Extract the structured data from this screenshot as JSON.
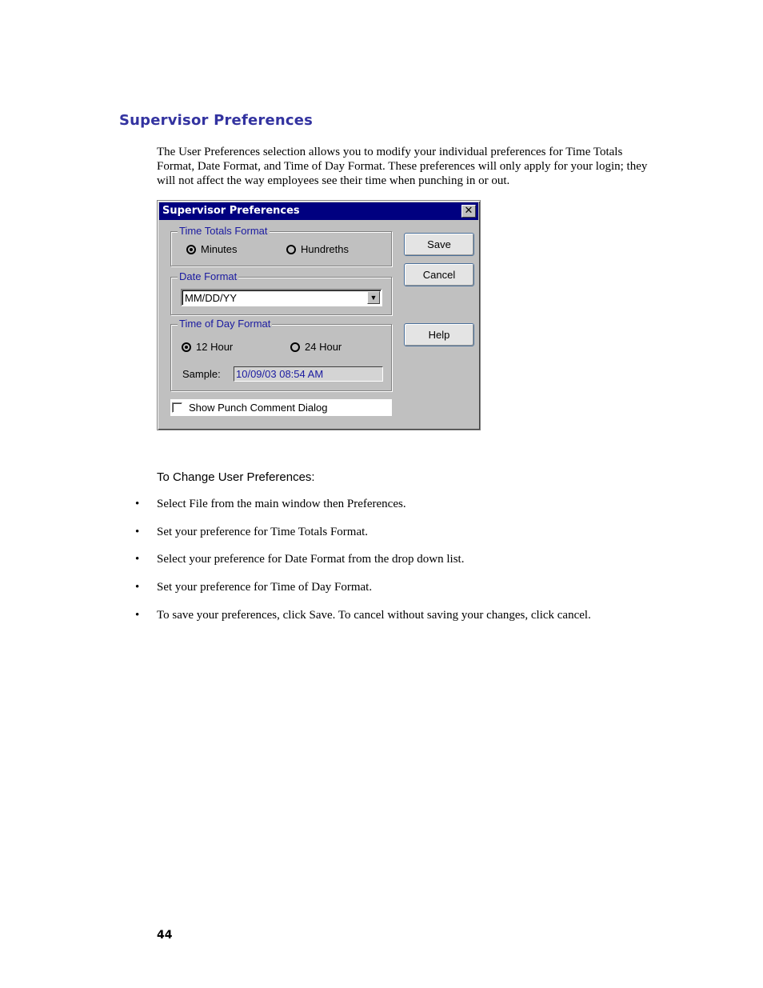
{
  "section_heading": "Supervisor Preferences",
  "intro_text": "The User Preferences selection allows you to modify your individual preferences for Time Totals Format, Date Format, and Time of Day Format. These preferences will only apply for your login; they will not affect the way employees see their time when punching in or out.",
  "dialog": {
    "title": "Supervisor Preferences",
    "close_icon": "close-icon",
    "time_totals": {
      "label": "Time Totals Format",
      "options": [
        {
          "label": "Minutes",
          "checked": true
        },
        {
          "label": "Hundreths",
          "checked": false
        }
      ]
    },
    "date_format": {
      "label": "Date Format",
      "value": "MM/DD/YY",
      "arrow_icon": "dropdown-arrow-icon"
    },
    "time_of_day": {
      "label": "Time of Day Format",
      "options": [
        {
          "label": "12 Hour",
          "checked": true
        },
        {
          "label": "24 Hour",
          "checked": false
        }
      ],
      "sample_label": "Sample:",
      "sample_value": "10/09/03 08:54 AM"
    },
    "show_punch_comment": {
      "label": "Show Punch Comment Dialog",
      "checked": false
    },
    "buttons": {
      "save": "Save",
      "cancel": "Cancel",
      "help": "Help"
    }
  },
  "instructions": {
    "heading": "To Change User Preferences:",
    "bullet": "•",
    "steps": [
      "Select File from the main window then Preferences.",
      "Set your preference for Time Totals Format.",
      "Select your preference for Date Format from the drop down list.",
      "Set your preference for Time of Day Format.",
      "To save your preferences, click Save. To cancel without saving your changes, click cancel."
    ]
  },
  "page_number": "44"
}
